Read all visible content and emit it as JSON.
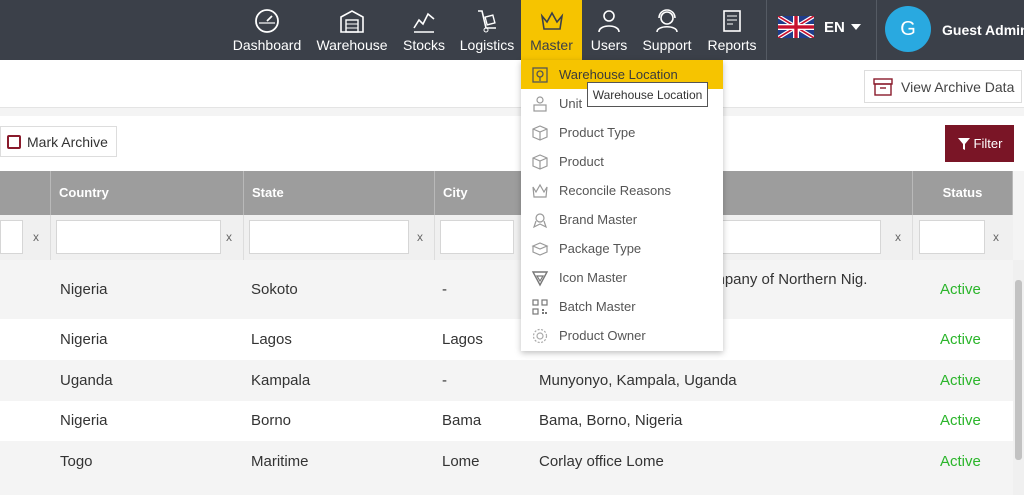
{
  "nav": {
    "items": [
      {
        "label": "Dashboard",
        "icon": "dashboard-icon"
      },
      {
        "label": "Warehouse",
        "icon": "warehouse-icon"
      },
      {
        "label": "Stocks",
        "icon": "stocks-chart-icon"
      },
      {
        "label": "Logistics",
        "icon": "dolly-icon"
      },
      {
        "label": "Master",
        "icon": "crown-icon"
      },
      {
        "label": "Users",
        "icon": "user-icon"
      },
      {
        "label": "Support",
        "icon": "headset-icon"
      },
      {
        "label": "Reports",
        "icon": "report-icon"
      }
    ],
    "active": "Master",
    "language": "EN",
    "avatar_initial": "G",
    "user_name": "Guest Admin"
  },
  "subheader": {
    "archive_button": "View Archive Data"
  },
  "toolbar": {
    "mark_archive": "Mark Archive",
    "filter": "Filter"
  },
  "table": {
    "columns": [
      "Country",
      "State",
      "City",
      "Status"
    ],
    "rows": [
      {
        "country": "Nigeria",
        "state": "Sokoto",
        "city": "-",
        "address": "ompany of Northern Nig.",
        "status": "Active"
      },
      {
        "country": "Nigeria",
        "state": "Lagos",
        "city": "Lagos",
        "address": "",
        "status": "Active"
      },
      {
        "country": "Uganda",
        "state": "Kampala",
        "city": "-",
        "address": "Munyonyo, Kampala, Uganda",
        "status": "Active"
      },
      {
        "country": "Nigeria",
        "state": "Borno",
        "city": "Bama",
        "address": "Bama, Borno, Nigeria",
        "status": "Active"
      },
      {
        "country": "Togo",
        "state": "Maritime",
        "city": "Lome",
        "address": "Corlay office Lome",
        "status": "Active"
      }
    ],
    "clear_symbol": "x"
  },
  "master_menu": {
    "items": [
      {
        "label": "Warehouse Location",
        "icon": "warehouse-location-icon"
      },
      {
        "label": "Unit",
        "icon": "unit-icon"
      },
      {
        "label": "Product Type",
        "icon": "box-icon"
      },
      {
        "label": "Product",
        "icon": "box-icon"
      },
      {
        "label": "Reconcile Reasons",
        "icon": "crown-icon"
      },
      {
        "label": "Brand Master",
        "icon": "badge-icon"
      },
      {
        "label": "Package Type",
        "icon": "package-icon"
      },
      {
        "label": "Icon Master",
        "icon": "vector-icon"
      },
      {
        "label": "Batch Master",
        "icon": "qr-icon"
      },
      {
        "label": "Product Owner",
        "icon": "gear-icon"
      }
    ],
    "active": "Warehouse Location",
    "tooltip": "Warehouse Location"
  },
  "colors": {
    "nav_bg": "#3b4049",
    "accent": "#f6c400",
    "brand": "#7a1526",
    "status_active": "#2ab52a",
    "avatar": "#29a9e0"
  }
}
